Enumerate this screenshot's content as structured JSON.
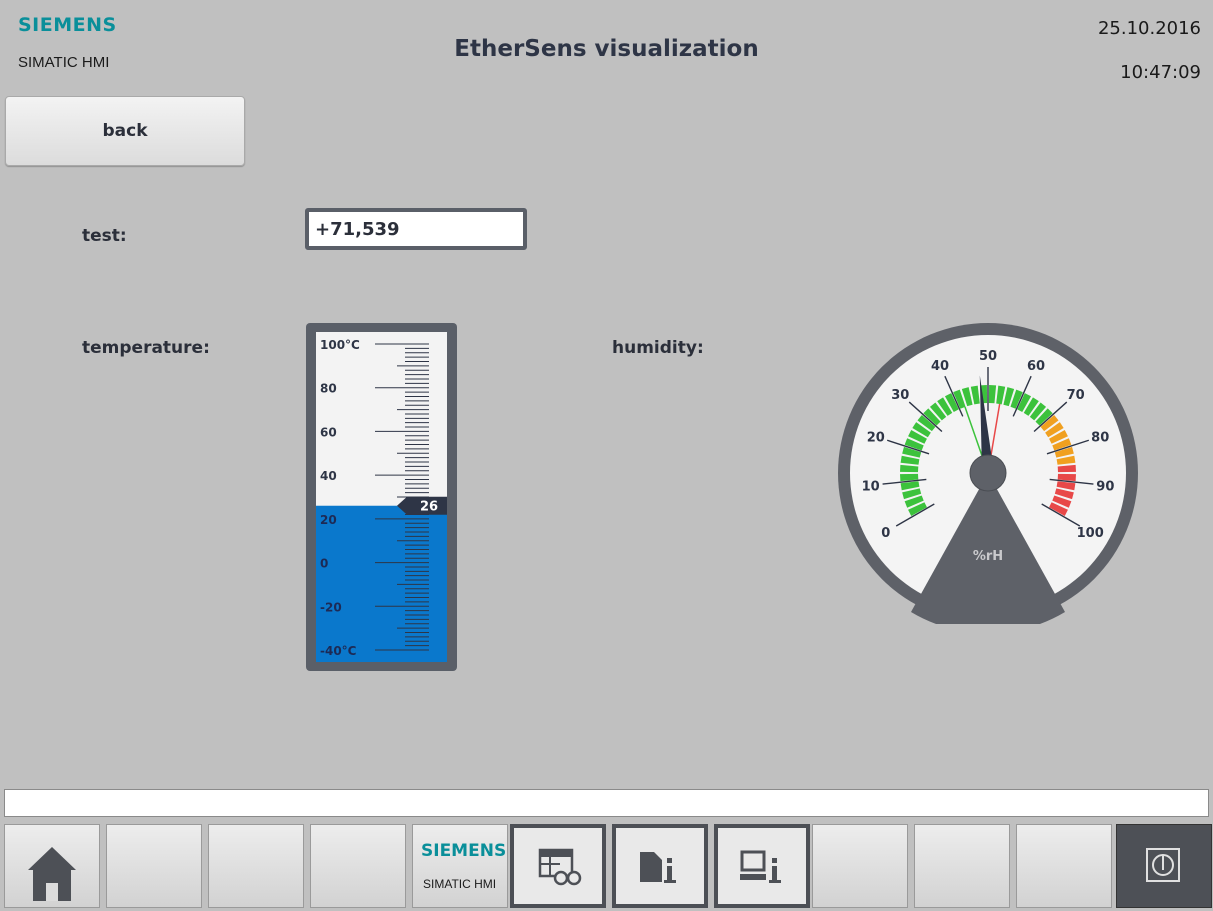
{
  "header": {
    "brand": "SIEMENS",
    "brand_sub": "SIMATIC HMI",
    "title": "EtherSens visualization",
    "date": "25.10.2016",
    "time": "10:47:09"
  },
  "buttons": {
    "back": "back"
  },
  "fields": {
    "test_label": "test:",
    "test_value": "+71,539",
    "temperature_label": "temperature:",
    "humidity_label": "humidity:"
  },
  "thermometer": {
    "min": -40,
    "max": 100,
    "value": 26,
    "value_text": "26",
    "ticks": [
      {
        "value": 100,
        "label": "100°C"
      },
      {
        "value": 80,
        "label": "80"
      },
      {
        "value": 60,
        "label": "60"
      },
      {
        "value": 40,
        "label": "40"
      },
      {
        "value": 20,
        "label": "20"
      },
      {
        "value": 0,
        "label": "0"
      },
      {
        "value": -20,
        "label": "-20"
      },
      {
        "value": -40,
        "label": "-40°C"
      }
    ],
    "colors": {
      "fill": "#0a78cc",
      "frame": "#5a5f68",
      "empty": "#f3f3f3"
    }
  },
  "gauge": {
    "min": 0,
    "max": 100,
    "value": 48,
    "unit": "%rH",
    "labels": [
      "0",
      "10",
      "20",
      "30",
      "40",
      "50",
      "60",
      "70",
      "80",
      "90",
      "100"
    ],
    "ranges": [
      {
        "from": 0,
        "to": 70,
        "color": "#3cc23c"
      },
      {
        "from": 70,
        "to": 85,
        "color": "#f0a020"
      },
      {
        "from": 85,
        "to": 100,
        "color": "#e84848"
      }
    ],
    "colors": {
      "bezel": "#5e6168",
      "face": "#f4f4f4",
      "needle": "#2e3546"
    }
  },
  "taskbar": {
    "brand": "SIEMENS",
    "brand_sub": "SIMATIC HMI",
    "icons": [
      "home-icon",
      "table-view-icon",
      "document-info-icon",
      "device-info-icon",
      "power-icon"
    ]
  }
}
